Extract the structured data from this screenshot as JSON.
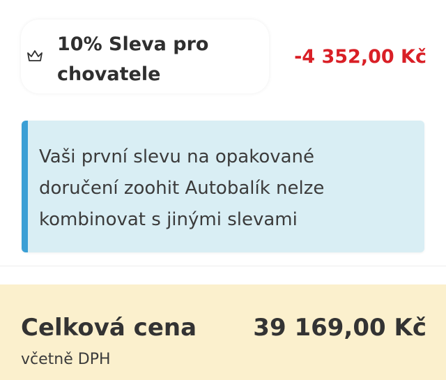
{
  "discount": {
    "label": "10% Sleva pro chovatele",
    "amount": "-4 352,00 Kč",
    "icon": "crown-icon"
  },
  "info": {
    "message": "Vaši první slevu na opakované doručení zoohit Autobalík nelze kombinovat s jinými slevami"
  },
  "total": {
    "label": "Celková cena",
    "amount": "39 169,00 Kč",
    "vat_note": "včetně DPH"
  },
  "colors": {
    "discount_red": "#d91f26",
    "info_bg": "#d9eef4",
    "info_accent": "#3a9fd5",
    "total_bg": "#fbf0cd"
  }
}
